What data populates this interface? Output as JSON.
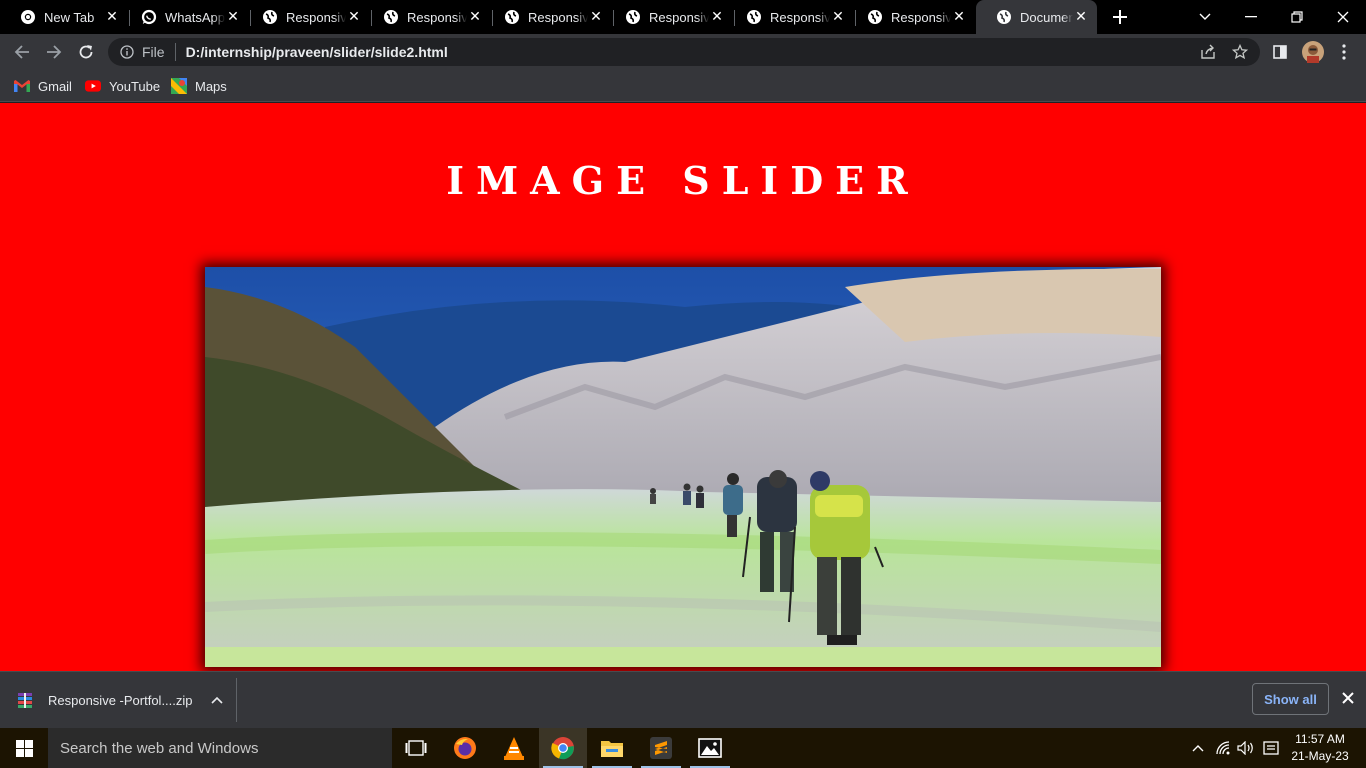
{
  "browser": {
    "tabs": [
      {
        "title": "New Tab",
        "icon": "chrome-icon",
        "active": false
      },
      {
        "title": "WhatsApp",
        "icon": "whatsapp-icon",
        "active": false
      },
      {
        "title": "Responsive",
        "icon": "globe-icon",
        "active": false
      },
      {
        "title": "Responsive",
        "icon": "globe-icon",
        "active": false
      },
      {
        "title": "Responsive",
        "icon": "globe-icon",
        "active": false
      },
      {
        "title": "Responsive",
        "icon": "globe-icon",
        "active": false
      },
      {
        "title": "Responsive",
        "icon": "globe-icon",
        "active": false
      },
      {
        "title": "Responsive",
        "icon": "globe-icon",
        "active": false
      },
      {
        "title": "Document",
        "icon": "globe-icon",
        "active": true
      }
    ],
    "address": {
      "scheme_label": "File",
      "url": "D:/internship/praveen/slider/slide2.html"
    },
    "bookmarks": [
      {
        "label": "Gmail",
        "icon": "gmail-icon"
      },
      {
        "label": "YouTube",
        "icon": "youtube-icon"
      },
      {
        "label": "Maps",
        "icon": "maps-icon"
      }
    ]
  },
  "page": {
    "title": "IMAGE SLIDER",
    "background_color": "#ff0000"
  },
  "downloads": {
    "file_name": "Responsive -Portfol....zip",
    "show_all_label": "Show all"
  },
  "taskbar": {
    "search_placeholder": "Search the web and Windows",
    "time": "11:57 AM",
    "date": "21-May-23"
  }
}
